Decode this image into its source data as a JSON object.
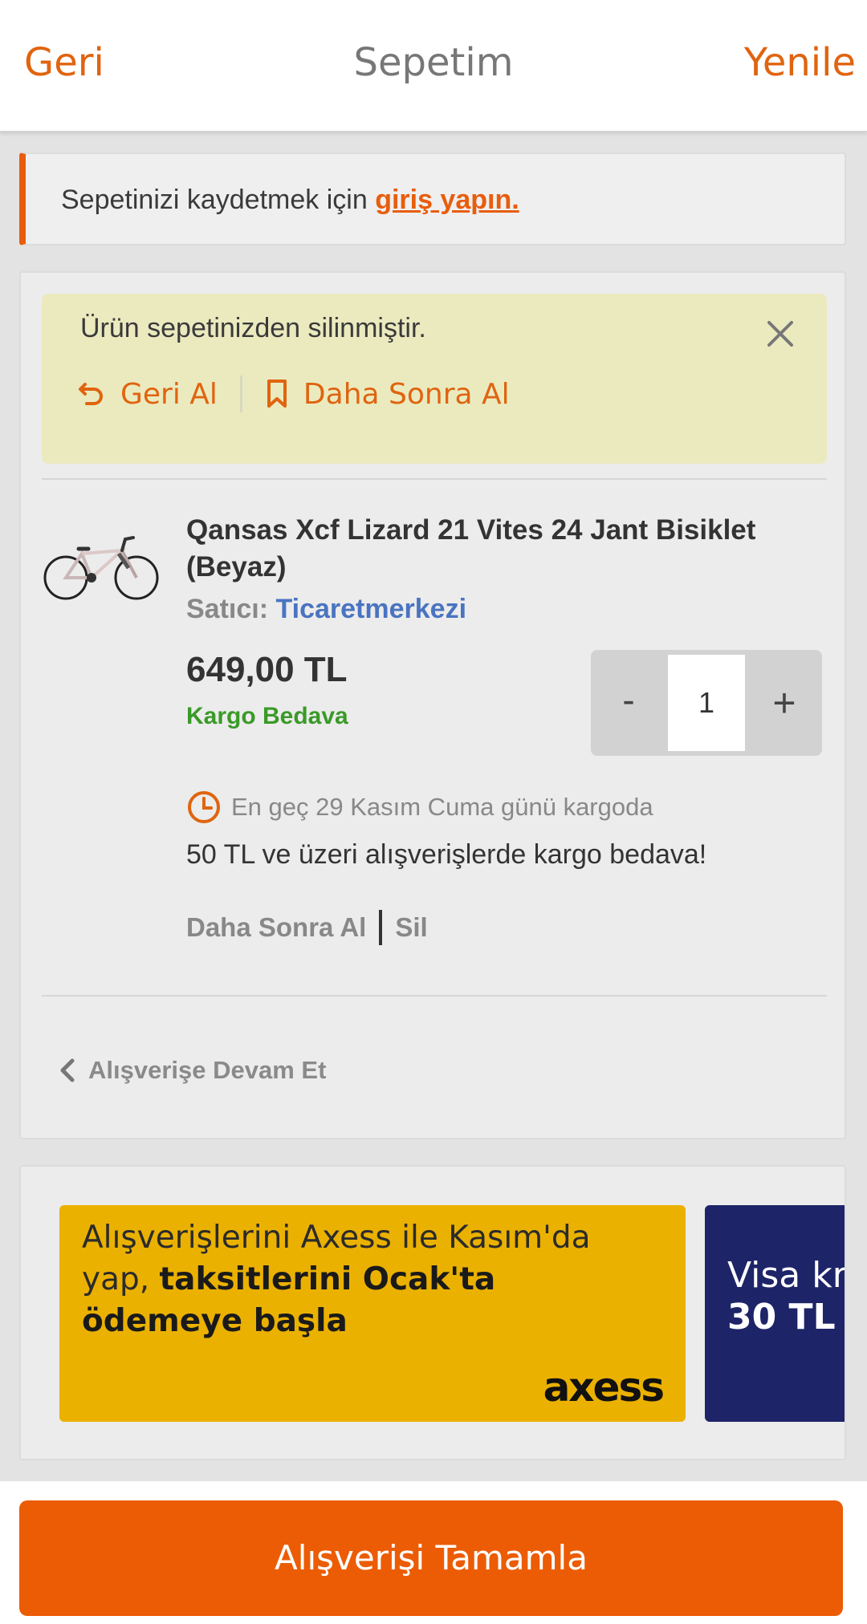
{
  "header": {
    "back_label": "Geri",
    "title": "Sepetim",
    "refresh_label": "Yenile"
  },
  "login_prompt": {
    "text": "Sepetinizi kaydetmek için ",
    "link": "giriş yapın."
  },
  "removed_notice": {
    "message": "Ürün sepetinizden silinmiştir.",
    "undo_label": "Geri Al",
    "save_later_label": "Daha Sonra Al",
    "close_icon": "close-icon"
  },
  "product": {
    "title": "Qansas Xcf Lizard 21 Vites 24 Jant Bisiklet (Beyaz)",
    "seller_label": "Satıcı:",
    "seller_name": "Ticaretmerkezi",
    "price": "649,00 TL",
    "shipping": "Kargo Bedava",
    "quantity": "1",
    "minus_label": "-",
    "plus_label": "+",
    "delivery_info": "En geç 29 Kasım Cuma günü kargoda",
    "free_shipping_note": "50 TL ve üzeri alışverişlerde kargo bedava!",
    "save_later_label": "Daha Sonra Al",
    "delete_label": "Sil"
  },
  "continue_shopping": "Alışverişe Devam Et",
  "banners": [
    {
      "line1": "Alışverişlerini Axess ile Kasım'da",
      "line2_normal": "yap, ",
      "line2_bold": "taksitlerini Ocak'ta",
      "line3": "ödemeye başla",
      "logo": "axess"
    },
    {
      "line1": "Visa kr",
      "line2": "30 TL"
    }
  ],
  "checkout_label": "Alışverişi Tamamla",
  "colors": {
    "accent": "#e0640f",
    "checkout": "#ec5c04",
    "seller_link": "#4a74c1",
    "free_shipping": "#3a9a28",
    "notice_bg": "#ebeabf",
    "banner_yellow": "#ebb100",
    "banner_navy": "#1d2467"
  }
}
